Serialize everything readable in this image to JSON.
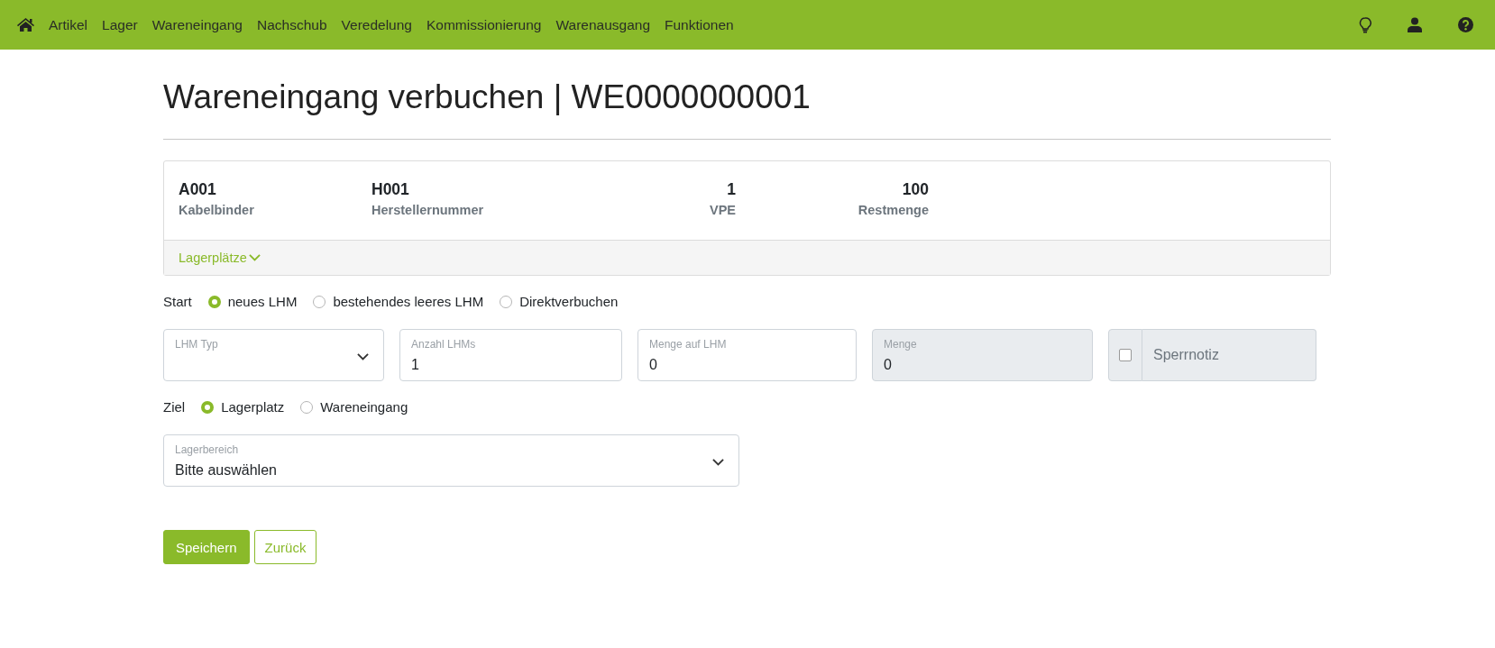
{
  "nav": {
    "items": [
      {
        "label": "Artikel"
      },
      {
        "label": "Lager"
      },
      {
        "label": "Wareneingang"
      },
      {
        "label": "Nachschub"
      },
      {
        "label": "Veredelung"
      },
      {
        "label": "Kommissionierung"
      },
      {
        "label": "Warenausgang"
      },
      {
        "label": "Funktionen"
      }
    ]
  },
  "title": "Wareneingang verbuchen | WE0000000001",
  "article": {
    "columns": [
      {
        "kind": "text",
        "value": "A001",
        "label": "Kabelbinder"
      },
      {
        "kind": "text",
        "value": "H001",
        "label": "Herstellernummer"
      },
      {
        "kind": "number",
        "value": "1",
        "label": "VPE"
      },
      {
        "kind": "number",
        "value": "100",
        "label": "Restmenge"
      }
    ],
    "toggle": {
      "label": "Lagerplätze",
      "expanded": false
    }
  },
  "start": {
    "label": "Start",
    "options": [
      {
        "label": "neues LHM",
        "selected": true
      },
      {
        "label": "bestehendes leeres LHM",
        "selected": false
      },
      {
        "label": "Direktverbuchen",
        "selected": false
      }
    ]
  },
  "fields": [
    {
      "kind": "select",
      "label": "LHM Typ",
      "disabled": false
    },
    {
      "kind": "input",
      "label": "Anzahl LHMs",
      "value": "1",
      "disabled": false
    },
    {
      "kind": "input",
      "label": "Menge auf LHM",
      "value": "0",
      "disabled": false
    },
    {
      "kind": "input",
      "label": "Menge",
      "value": "0",
      "disabled": true
    },
    {
      "kind": "checkbox-input",
      "placeholder": "Sperrnotiz",
      "checked": false
    }
  ],
  "target": {
    "label": "Ziel",
    "options": [
      {
        "label": "Lagerplatz",
        "selected": true
      },
      {
        "label": "Wareneingang",
        "selected": false
      }
    ]
  },
  "area": {
    "label": "Lagerbereich",
    "value": "Bitte auswählen"
  },
  "buttons": [
    {
      "kind": "primary",
      "label": "Speichern"
    },
    {
      "kind": "outline",
      "label": "Zurück"
    }
  ]
}
